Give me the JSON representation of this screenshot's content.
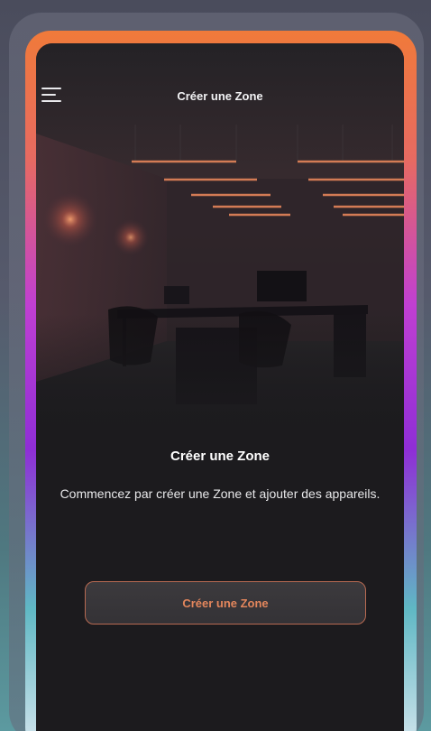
{
  "header": {
    "menu_icon": "hamburger-menu-icon",
    "title": "Créer une Zone"
  },
  "empty_state": {
    "title": "Créer une Zone",
    "description": "Commencez par créer une Zone et ajouter des appareils."
  },
  "cta": {
    "label": "Créer une Zone"
  },
  "colors": {
    "accent": "#e3865c",
    "app_background": "#1c1b1e",
    "border_glow_top": "#f07a3a",
    "border_glow_mid": "#8f2ed6",
    "border_glow_bottom": "#5fb8c4"
  }
}
